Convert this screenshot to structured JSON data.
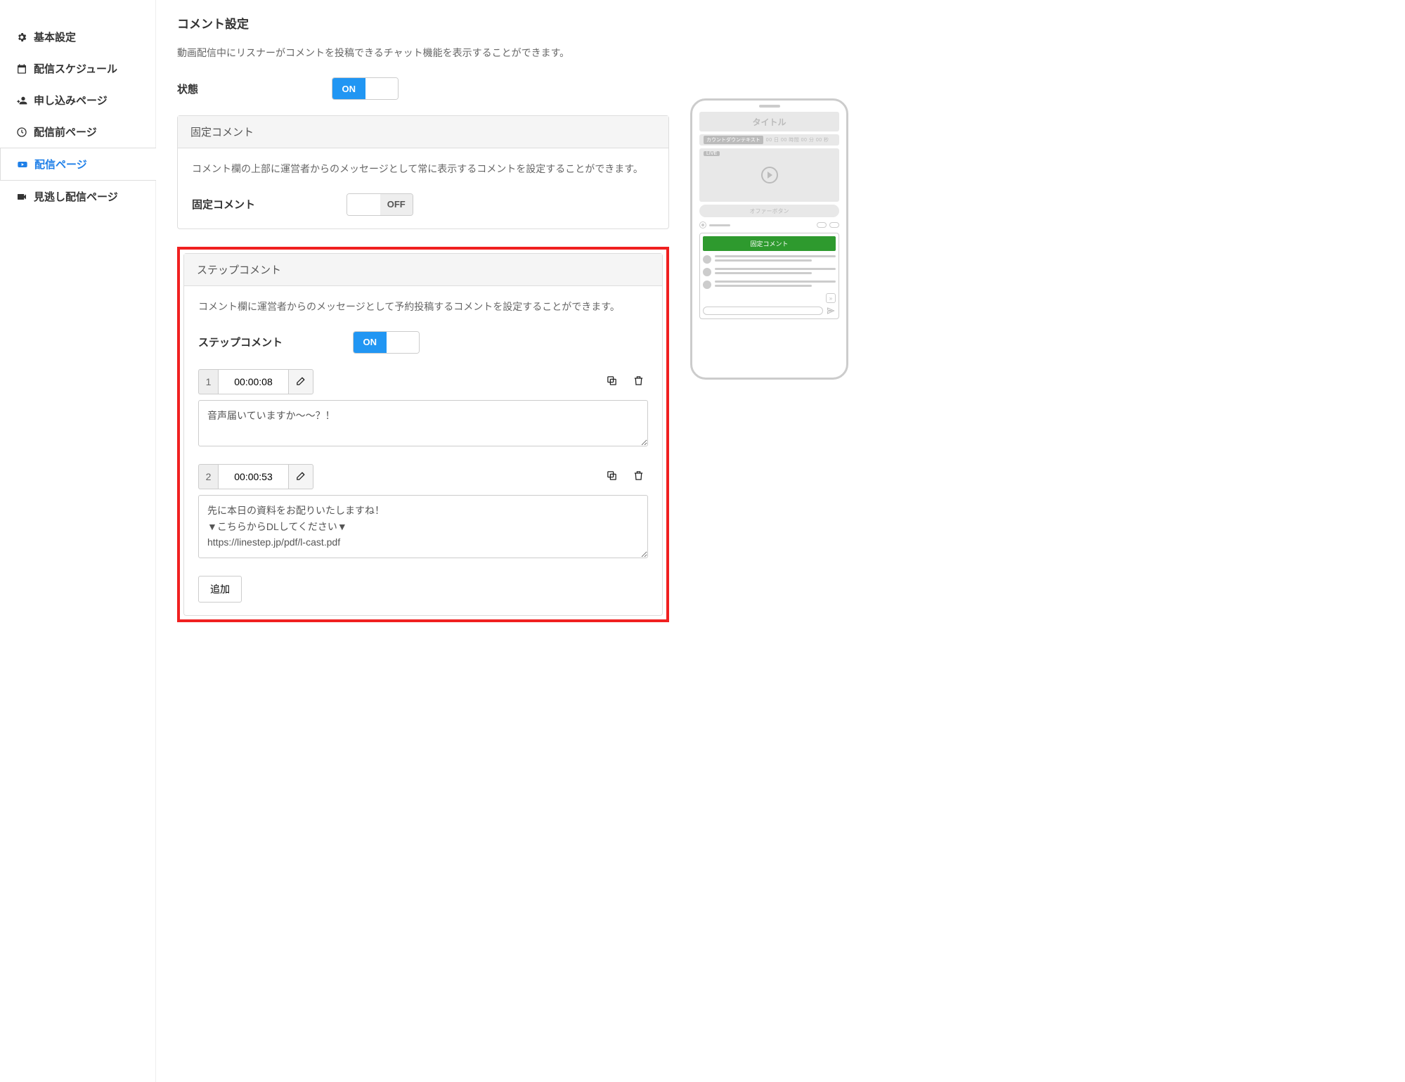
{
  "sidebar": {
    "items": [
      {
        "label": "基本設定"
      },
      {
        "label": "配信スケジュール"
      },
      {
        "label": "申し込みページ"
      },
      {
        "label": "配信前ページ"
      },
      {
        "label": "配信ページ"
      },
      {
        "label": "見逃し配信ページ"
      }
    ]
  },
  "page": {
    "title": "コメント設定",
    "intro": "動画配信中にリスナーがコメントを投稿できるチャット機能を表示することができます。",
    "state_label": "状態",
    "state_on": "ON"
  },
  "fixed_panel": {
    "header": "固定コメント",
    "desc": "コメント欄の上部に運営者からのメッセージとして常に表示するコメントを設定することができます。",
    "label": "固定コメント",
    "off": "OFF"
  },
  "step_panel": {
    "header": "ステップコメント",
    "desc": "コメント欄に運営者からのメッセージとして予約投稿するコメントを設定することができます。",
    "label": "ステップコメント",
    "on": "ON",
    "items": [
      {
        "index": "1",
        "time": "00:00:08",
        "text": "音声届いていますか〜〜？！"
      },
      {
        "index": "2",
        "time": "00:00:53",
        "text": "先に本日の資料をお配りいたしますね！\n▼こちらからDLしてください▼\nhttps://linestep.jp/pdf/l-cast.pdf"
      }
    ],
    "add_label": "追加"
  },
  "preview": {
    "title": "タイトル",
    "countdown_tag": "カウントダウンテキスト",
    "countdown_nums": "00 日 00 時間 00 分 00 秒",
    "live": "LIVE",
    "offer": "オファーボタン",
    "fixed": "固定コメント"
  }
}
